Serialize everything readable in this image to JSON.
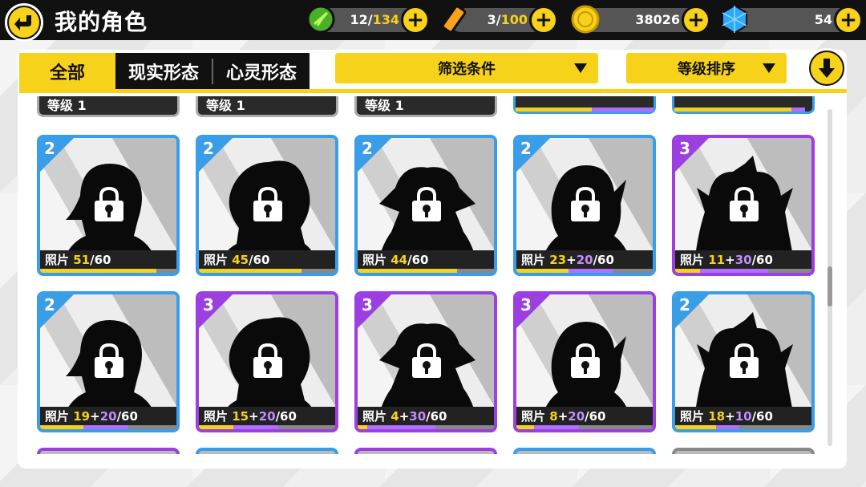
{
  "header": {
    "title": "我的角色"
  },
  "resources": [
    {
      "name": "stamina",
      "icon": "green-leaf-icon",
      "value": "12",
      "max": "134"
    },
    {
      "name": "battery",
      "icon": "battery-icon",
      "value": "3",
      "max": "100"
    },
    {
      "name": "coins",
      "icon": "coin-icon",
      "value": "38026",
      "max": ""
    },
    {
      "name": "gems",
      "icon": "blue-gem-icon",
      "value": "54",
      "max": ""
    }
  ],
  "tabs": [
    "全部",
    "现实形态",
    "心灵形态"
  ],
  "filters": {
    "filter_label": "筛选条件",
    "sort_label": "等级排序"
  },
  "partial_labels": {
    "level": "等级 1",
    "photo_prefix": "照片"
  },
  "photo_label": "照片",
  "cards": [
    {
      "rank": "2",
      "owned": "51",
      "bonus": "",
      "total": "/60",
      "progress": 0.85,
      "bonus_progress": 0,
      "rarity": 2
    },
    {
      "rank": "2",
      "owned": "45",
      "bonus": "",
      "total": "/60",
      "progress": 0.75,
      "bonus_progress": 0,
      "rarity": 2
    },
    {
      "rank": "2",
      "owned": "44",
      "bonus": "",
      "total": "/60",
      "progress": 0.73,
      "bonus_progress": 0,
      "rarity": 2
    },
    {
      "rank": "2",
      "owned": "23",
      "bonus": "+20",
      "total": "/60",
      "progress": 0.38,
      "bonus_progress": 0.33,
      "rarity": 2
    },
    {
      "rank": "3",
      "owned": "11",
      "bonus": "+30",
      "total": "/60",
      "progress": 0.18,
      "bonus_progress": 0.5,
      "rarity": 3
    },
    {
      "rank": "2",
      "owned": "19",
      "bonus": "+20",
      "total": "/60",
      "progress": 0.32,
      "bonus_progress": 0.33,
      "rarity": 2
    },
    {
      "rank": "3",
      "owned": "15",
      "bonus": "+20",
      "total": "/60",
      "progress": 0.25,
      "bonus_progress": 0.33,
      "rarity": 3
    },
    {
      "rank": "3",
      "owned": "4",
      "bonus": "+30",
      "total": "/60",
      "progress": 0.07,
      "bonus_progress": 0.5,
      "rarity": 3
    },
    {
      "rank": "3",
      "owned": "8",
      "bonus": "+20",
      "total": "/60",
      "progress": 0.13,
      "bonus_progress": 0.33,
      "rarity": 3
    },
    {
      "rank": "2",
      "owned": "18",
      "bonus": "+10",
      "total": "/60",
      "progress": 0.3,
      "bonus_progress": 0.17,
      "rarity": 2
    }
  ],
  "colors": {
    "accent": "#f7d21a",
    "rank2": "#3a9de8",
    "rank3": "#9b3fe0"
  }
}
